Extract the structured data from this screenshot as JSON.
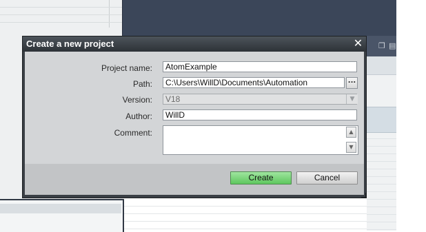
{
  "dialog": {
    "title": "Create a new project",
    "close_icon": "close-icon"
  },
  "form": {
    "project_name": {
      "label": "Project name:",
      "value": "AtomExample"
    },
    "path": {
      "label": "Path:",
      "value": "C:\\Users\\WillD\\Documents\\Automation",
      "browse_label": "..."
    },
    "version": {
      "label": "Version:",
      "value": "V18"
    },
    "author": {
      "label": "Author:",
      "value": "WillD"
    },
    "comment": {
      "label": "Comment:",
      "value": ""
    }
  },
  "buttons": {
    "create": "Create",
    "cancel": "Cancel"
  },
  "colors": {
    "create_button": "#6fd36f",
    "title_bar": "#3a3f45",
    "background_header": "#3b4659"
  }
}
